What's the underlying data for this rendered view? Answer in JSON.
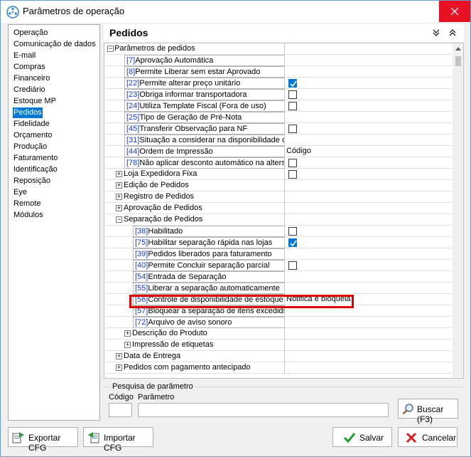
{
  "window": {
    "title": "Parâmetros de operação",
    "title_icon": "gear-icon",
    "close_icon": "close-icon"
  },
  "sidebar": {
    "items": [
      {
        "label": "Operação"
      },
      {
        "label": "Comunicação de dados"
      },
      {
        "label": "E-mail"
      },
      {
        "label": "Compras"
      },
      {
        "label": "Financeiro"
      },
      {
        "label": "Crediário"
      },
      {
        "label": "Estoque MP"
      },
      {
        "label": "Pedidos",
        "selected": true
      },
      {
        "label": "Fidelidade"
      },
      {
        "label": "Orçamento"
      },
      {
        "label": "Produção"
      },
      {
        "label": "Faturamento"
      },
      {
        "label": "Identificação"
      },
      {
        "label": "Reposição"
      },
      {
        "label": "Eye"
      },
      {
        "label": "Remote"
      },
      {
        "label": "Módulos"
      }
    ]
  },
  "panel": {
    "title": "Pedidos",
    "collapse_all_icon": "chevron-double-down-icon",
    "expand_all_icon": "chevron-double-up-icon"
  },
  "grid": {
    "rows": [
      {
        "level": 0,
        "expander": "−",
        "text": "Parâmetros de pedidos"
      },
      {
        "level": 1,
        "code": "[7]",
        "text": "Aprovação Automática"
      },
      {
        "level": 1,
        "code": "[8]",
        "text": "Permite Liberar sem estar Aprovado"
      },
      {
        "level": 1,
        "code": "[22]",
        "text": "Permite alterar preço unitário",
        "checkbox": "checked"
      },
      {
        "level": 1,
        "code": "[23]",
        "text": "Obriga informar transportadora",
        "checkbox": "unchecked"
      },
      {
        "level": 1,
        "code": "[24]",
        "text": "Utiliza Template Fiscal (Fora de uso)",
        "checkbox": "unchecked"
      },
      {
        "level": 1,
        "code": "[25]",
        "text": "Tipo de Geração de Pré-Nota"
      },
      {
        "level": 1,
        "code": "[45]",
        "text": "Transferir Observação para NF",
        "checkbox": "unchecked"
      },
      {
        "level": 1,
        "code": "[31]",
        "text": "Situação a considerar na disponibilidade d"
      },
      {
        "level": 1,
        "code": "[44]",
        "text": "Ordem de Impressão",
        "value": "Código"
      },
      {
        "level": 1,
        "code": "[78]",
        "text": "Não aplicar desconto automático na alters",
        "checkbox": "unchecked"
      },
      {
        "level": 1,
        "expander": "+",
        "text": "Loja Expedidora Fixa",
        "checkbox": "unchecked"
      },
      {
        "level": 1,
        "expander": "+",
        "text": "Edição de Pedidos"
      },
      {
        "level": 1,
        "expander": "+",
        "text": "Registro de Pedidos"
      },
      {
        "level": 1,
        "expander": "+",
        "text": "Aprovação de Pedidos"
      },
      {
        "level": 1,
        "expander": "−",
        "text": "Separação de Pedidos"
      },
      {
        "level": 2,
        "code": "[38]",
        "text": "Habilitado",
        "checkbox": "unchecked"
      },
      {
        "level": 2,
        "code": "[75]",
        "text": "Habilitar separação rápida nas lojas",
        "checkbox": "checked"
      },
      {
        "level": 2,
        "code": "[39]",
        "text": "Pedidos liberados para faturamento"
      },
      {
        "level": 2,
        "code": "[40]",
        "text": "Permite Concluir separação parcial",
        "checkbox": "unchecked"
      },
      {
        "level": 2,
        "code": "[54]",
        "text": "Entrada de Separação"
      },
      {
        "level": 2,
        "code": "[55]",
        "text": "Liberar a separação automaticamente"
      },
      {
        "level": 2,
        "code": "[56]",
        "text": "Controle de disponibilidade de estoque",
        "value": "Notifica e bloqueia"
      },
      {
        "level": 2,
        "code": "[57]",
        "text": "Bloquear a separação de itens excedids"
      },
      {
        "level": 2,
        "code": "[72]",
        "text": "Arquivo de aviso sonoro"
      },
      {
        "level": 2,
        "expander": "+",
        "text": "Descrição do Produto"
      },
      {
        "level": 2,
        "expander": "+",
        "text": "Impressão de etiquetas"
      },
      {
        "level": 1,
        "expander": "+",
        "text": "Data de Entrega"
      },
      {
        "level": 1,
        "expander": "+",
        "text": "Pedidos com pagamento antecipado"
      }
    ]
  },
  "search": {
    "legend": "Pesquisa de parâmetro",
    "code_label": "Código",
    "param_label": "Parâmetro",
    "code_value": "",
    "param_value": "",
    "search_button": "Buscar (F3)",
    "search_icon": "magnifier-icon"
  },
  "footer": {
    "export_label": "Exportar CFG",
    "import_label": "Importar CFG",
    "save_label": "Salvar",
    "cancel_label": "Cancelar",
    "export_icon": "export-icon",
    "import_icon": "import-icon",
    "save_icon": "checkmark-icon",
    "cancel_icon": "x-icon"
  },
  "colors": {
    "accent": "#0078d7",
    "code_link": "#1a3dcc",
    "highlight": "#e00000",
    "close_button": "#e81123"
  }
}
